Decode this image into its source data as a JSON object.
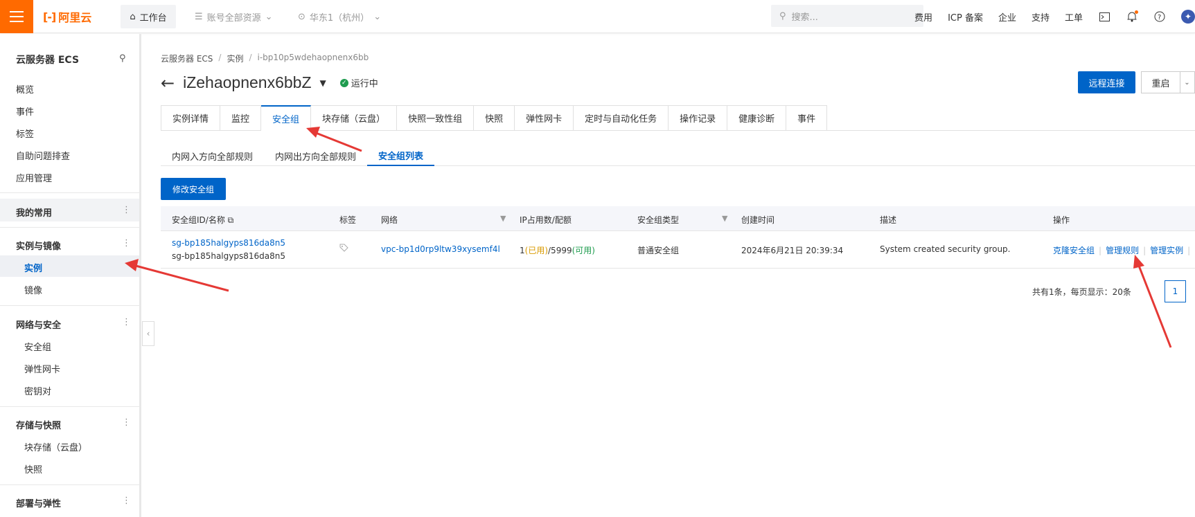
{
  "topbar": {
    "logo_text": "阿里云",
    "logo_mark": "[-]",
    "console": "工作台",
    "account_resources": "账号全部资源",
    "region": "华东1（杭州）",
    "search_placeholder": "搜索...",
    "links": [
      "费用",
      "ICP 备案",
      "企业",
      "支持",
      "工单"
    ],
    "accent_color": "#ff6a00"
  },
  "sidebar": {
    "title": "云服务器 ECS",
    "top_items": [
      "概览",
      "事件",
      "标签",
      "自助问题排查",
      "应用管理"
    ],
    "favorites": "我的常用",
    "group_instances": "实例与镜像",
    "instances": "实例",
    "images": "镜像",
    "group_network": "网络与安全",
    "security_groups": "安全组",
    "eni": "弹性网卡",
    "keypair": "密钥对",
    "group_storage": "存储与快照",
    "block_storage": "块存储（云盘）",
    "snapshots": "快照",
    "group_deploy": "部署与弹性"
  },
  "breadcrumb": [
    "云服务器 ECS",
    "实例",
    "i-bp10p5wdehaopnenx6bb"
  ],
  "instance": {
    "name": "iZehaopnenx6bbZ",
    "status": "运行中",
    "status_color": "#1f9c4f"
  },
  "actions": {
    "remote_connect": "远程连接",
    "restart": "重启"
  },
  "tabs": [
    "实例详情",
    "监控",
    "安全组",
    "块存储（云盘）",
    "快照一致性组",
    "快照",
    "弹性网卡",
    "定时与自动化任务",
    "操作记录",
    "健康诊断",
    "事件"
  ],
  "active_tab": "安全组",
  "subtabs": [
    "内网入方向全部规则",
    "内网出方向全部规则",
    "安全组列表"
  ],
  "modify_button": "修改安全组",
  "table": {
    "headers": [
      "安全组ID/名称",
      "标签",
      "网络",
      "IP占用数/配额",
      "安全组类型",
      "创建时间",
      "描述",
      "操作"
    ],
    "row": {
      "id": "sg-bp185halgyps816da8n5",
      "name": "sg-bp185halgyps816da8n5",
      "vpc": "vpc-bp1d0rp9ltw39xysemf4l",
      "ip_used_num": "1",
      "ip_used_label": "(已用)",
      "ip_quota_num": "/5999",
      "ip_avail_label": "(可用)",
      "type": "普通安全组",
      "created": "2024年6月21日 20:39:34",
      "description": "System created security group.",
      "ops": [
        "克隆安全组",
        "管理规则",
        "管理实例"
      ]
    }
  },
  "pagination": {
    "summary": "共有1条，每页显示：20条",
    "page": "1"
  }
}
